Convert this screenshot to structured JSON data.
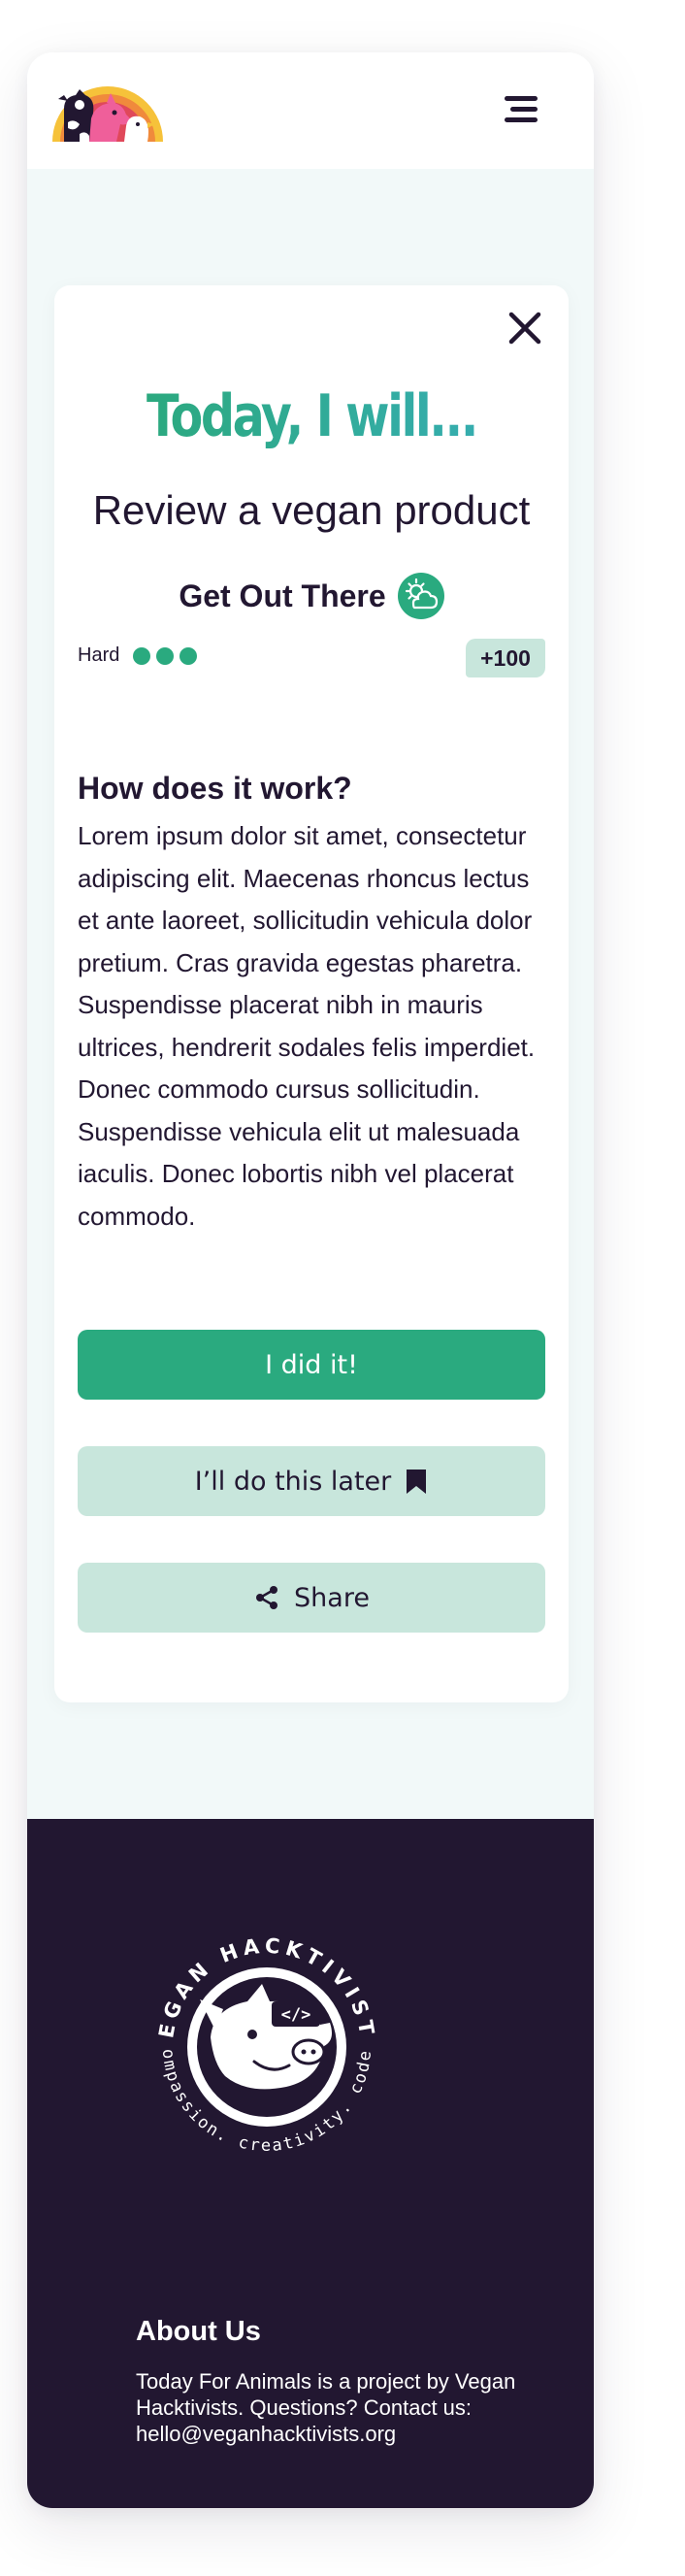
{
  "header": {
    "logo_alt": "Today For Animals",
    "menu_icon": "hamburger-menu-icon"
  },
  "card": {
    "close_icon": "close-icon",
    "headline": "Today, I will...",
    "task_title": "Review a vegan product",
    "category": {
      "label": "Get Out There",
      "icon": "sun-behind-cloud-icon"
    },
    "difficulty": {
      "label": "Hard",
      "level": 3,
      "max": 3
    },
    "points": "+100",
    "how_title": "How does it work?",
    "description": "Lorem ipsum dolor sit amet, consectetur adipiscing elit. Maecenas rhoncus lectus et ante laoreet, sollicitudin vehicula dolor pretium. Cras gravida egestas pharetra. Suspendisse placerat nibh in mauris ultrices, hendrerit sodales felis imperdiet. Donec commodo cursus sollicitudin. Suspendisse vehicula elit ut malesuada iaculis. Donec lobortis nibh vel placerat commodo.",
    "buttons": {
      "done": "I did it!",
      "later": "I’ll do this later",
      "later_icon": "bookmark-icon",
      "share": "Share",
      "share_icon": "share-icon"
    }
  },
  "footer": {
    "logo": {
      "top_text": "VEGAN HACKTIVISTS",
      "bottom_text": "compassion. creativity. code.",
      "code_text": "</>"
    },
    "about_title": "About Us",
    "about_text": "Today For Animals is a project by Vegan Hacktivists. Questions? Contact us: hello@veganhacktivists.org"
  },
  "colors": {
    "primary": "#2aaa7f",
    "primary_light": "#c8e6dc",
    "dark": "#221731",
    "page_bg": "#f2f9f9"
  }
}
